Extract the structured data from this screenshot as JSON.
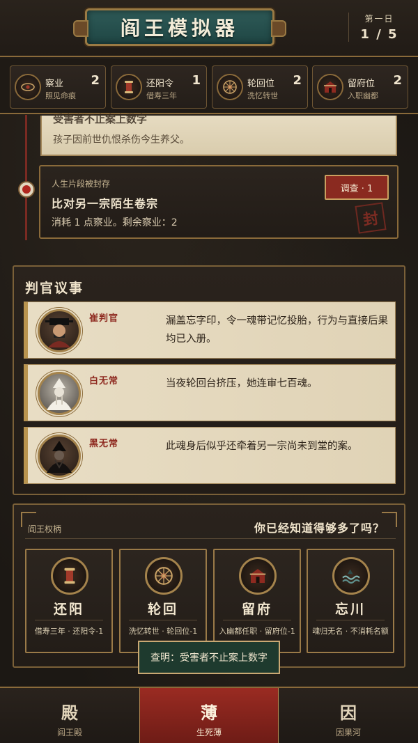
{
  "header": {
    "title": "阎王模拟器",
    "day_label": "第一日",
    "day_count": "1 / 5"
  },
  "resources": [
    {
      "name": "察业",
      "sub": "照见命痕",
      "count": "2",
      "icon": "eye-icon"
    },
    {
      "name": "还阳令",
      "sub": "借寿三年",
      "count": "1",
      "icon": "scroll-icon"
    },
    {
      "name": "轮回位",
      "sub": "洗忆转世",
      "count": "2",
      "icon": "wheel-icon"
    },
    {
      "name": "留府位",
      "sub": "入职幽都",
      "count": "2",
      "icon": "gate-icon"
    }
  ],
  "timeline": {
    "top_entry": {
      "title": "受害者不止案上数字",
      "desc": "孩子因前世仇恨杀伤今生养父。"
    },
    "sealed_entry": {
      "kicker": "人生片段被封存",
      "title": "比对另一宗陌生卷宗",
      "desc": "消耗 1 点察业。剩余察业：2",
      "button": "调查 · 1",
      "stamp": "封"
    }
  },
  "judges": {
    "title": "判官议事",
    "items": [
      {
        "name": "崔判官",
        "text": "漏盖忘字印，令一魂带记忆投胎，行为与直接后果均已入册。",
        "icon": "judge-cui-icon"
      },
      {
        "name": "白无常",
        "text": "当夜轮回台挤压，她连审七百魂。",
        "icon": "white-impermanence-icon"
      },
      {
        "name": "黑无常",
        "text": "此魂身后似乎还牵着另一宗尚未到堂的案。",
        "icon": "black-impermanence-icon"
      }
    ]
  },
  "powers": {
    "label": "阎王权柄",
    "question": "你已经知道得够多了吗？",
    "items": [
      {
        "name": "还阳",
        "desc": "借寿三年 · 还阳令-1",
        "icon": "scroll-icon"
      },
      {
        "name": "轮回",
        "desc": "洗忆转世 · 轮回位-1",
        "icon": "wheel-icon"
      },
      {
        "name": "留府",
        "desc": "入幽都任职 · 留府位-1",
        "icon": "gate-icon"
      },
      {
        "name": "忘川",
        "desc": "魂归无名 · 不消耗名额",
        "icon": "river-icon"
      }
    ]
  },
  "toast": "查明：受害者不止案上数字",
  "nav": [
    {
      "glyph": "殿",
      "label": "阎王殿"
    },
    {
      "glyph": "薄",
      "label": "生死薄"
    },
    {
      "glyph": "因",
      "label": "因果河"
    }
  ],
  "colors": {
    "accent_red": "#9a2b22",
    "gold_border": "#9a7a48",
    "parchment": "#e6dbc1",
    "teal_plaque": "#2e5a57"
  }
}
